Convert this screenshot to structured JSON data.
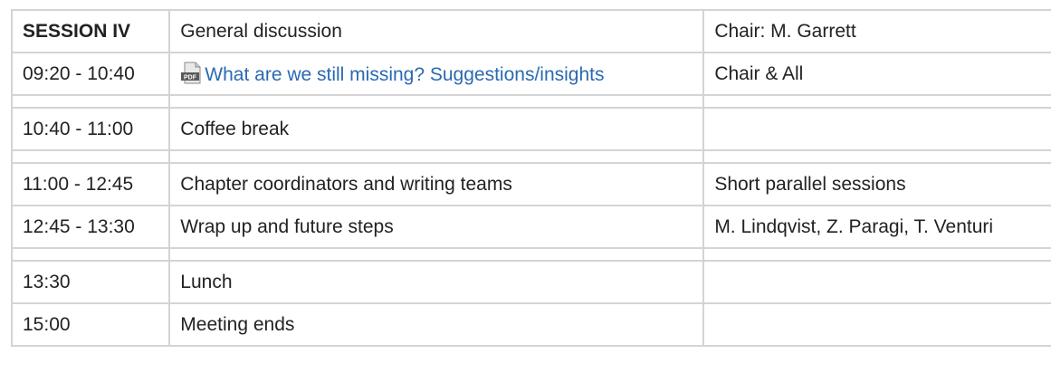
{
  "session": {
    "title": "SESSION IV",
    "topic": "General discussion",
    "chair": "Chair: M. Garrett"
  },
  "rows": [
    {
      "time": "09:20 - 10:40",
      "event": "What are we still missing? Suggestions/insights",
      "who": "Chair & All",
      "link": true,
      "icon": "pdf-icon"
    },
    {
      "gap": true
    },
    {
      "time": "10:40 - 11:00",
      "event": "Coffee break",
      "who": ""
    },
    {
      "gap": true
    },
    {
      "time": "11:00 - 12:45",
      "event": "Chapter coordinators and writing teams",
      "who": "Short parallel sessions"
    },
    {
      "time": "12:45 - 13:30",
      "event": "Wrap up and future steps",
      "who": "M. Lindqvist, Z. Paragi, T. Venturi"
    },
    {
      "gap": true
    },
    {
      "time": "13:30",
      "event": "Lunch",
      "who": ""
    },
    {
      "time": "15:00",
      "event": "Meeting ends",
      "who": ""
    }
  ],
  "colors": {
    "link": "#2a6ab1",
    "border": "#d4d4d4",
    "text": "#222222"
  }
}
